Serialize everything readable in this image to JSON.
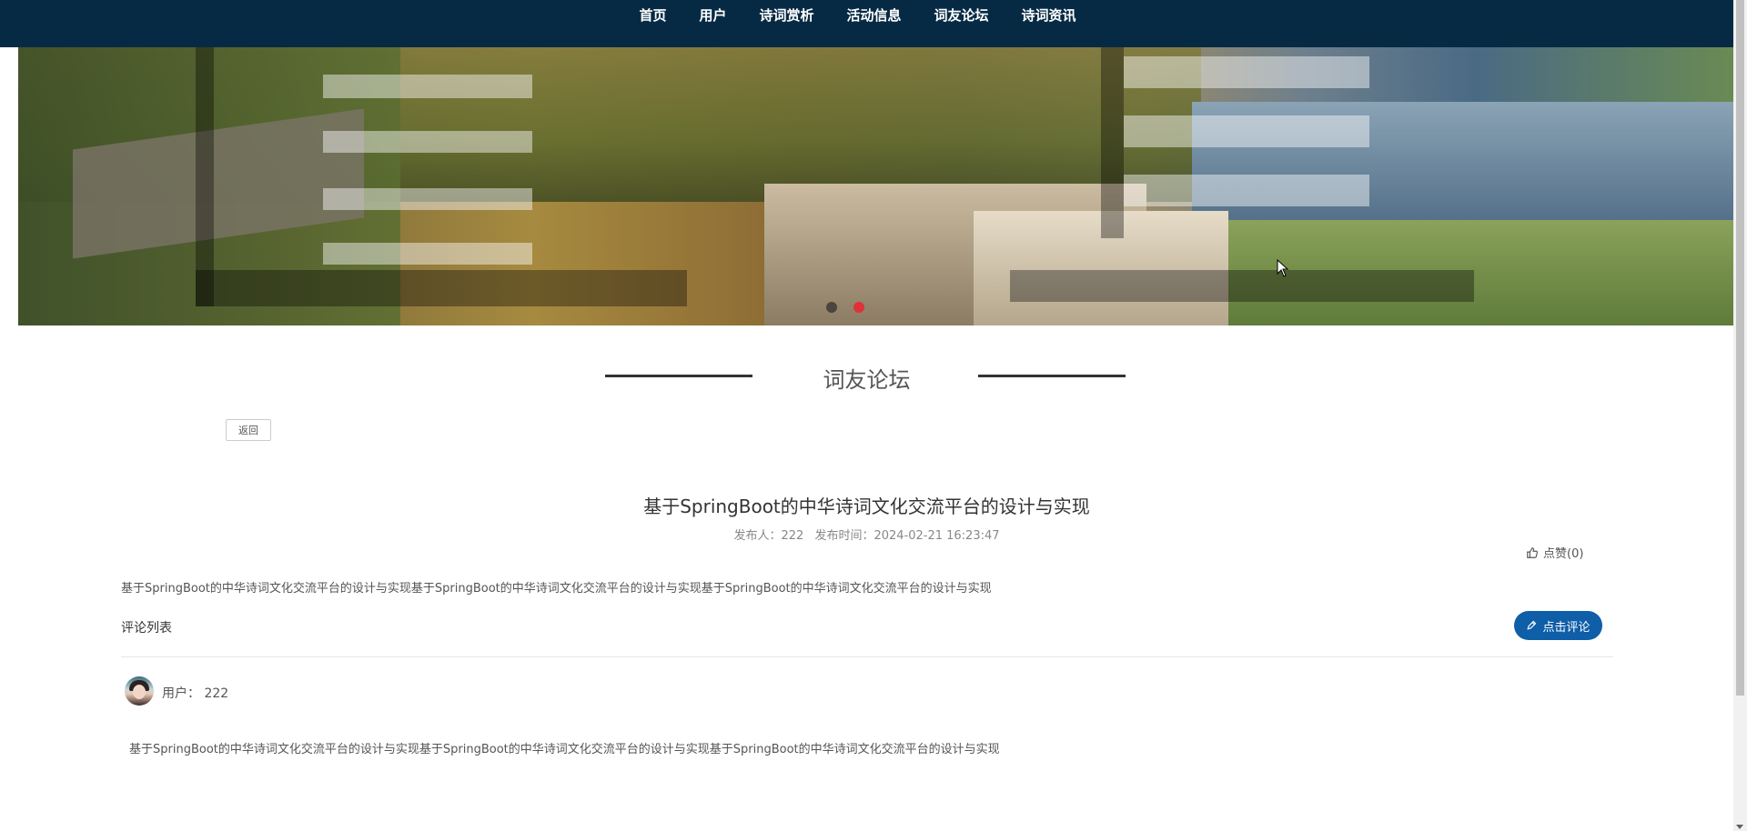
{
  "nav": {
    "items": [
      {
        "label": "首页"
      },
      {
        "label": "用户"
      },
      {
        "label": "诗词赏析"
      },
      {
        "label": "活动信息"
      },
      {
        "label": "词友论坛"
      },
      {
        "label": "诗词资讯"
      }
    ]
  },
  "carousel": {
    "active_index": 1,
    "count": 2,
    "dot_active_color": "#e0303a"
  },
  "section": {
    "title": "词友论坛"
  },
  "back_button": {
    "label": "返回"
  },
  "post": {
    "title": "基于SpringBoot的中华诗词文化交流平台的设计与实现",
    "author_label": "发布人：222",
    "time_label": "发布时间：2024-02-21 16:23:47",
    "like_label": "点赞(0)",
    "content": "基于SpringBoot的中华诗词文化交流平台的设计与实现基于SpringBoot的中华诗词文化交流平台的设计与实现基于SpringBoot的中华诗词文化交流平台的设计与实现"
  },
  "comments": {
    "heading": "评论列表",
    "add_button_label": "点击评论",
    "accent_color": "#0e5ea8",
    "items": [
      {
        "user_label": "用户：  222",
        "text": "基于SpringBoot的中华诗词文化交流平台的设计与实现基于SpringBoot的中华诗词文化交流平台的设计与实现基于SpringBoot的中华诗词文化交流平台的设计与实现"
      }
    ]
  },
  "icons": {
    "like": "thumbs-up-icon",
    "comment": "pencil-icon"
  }
}
